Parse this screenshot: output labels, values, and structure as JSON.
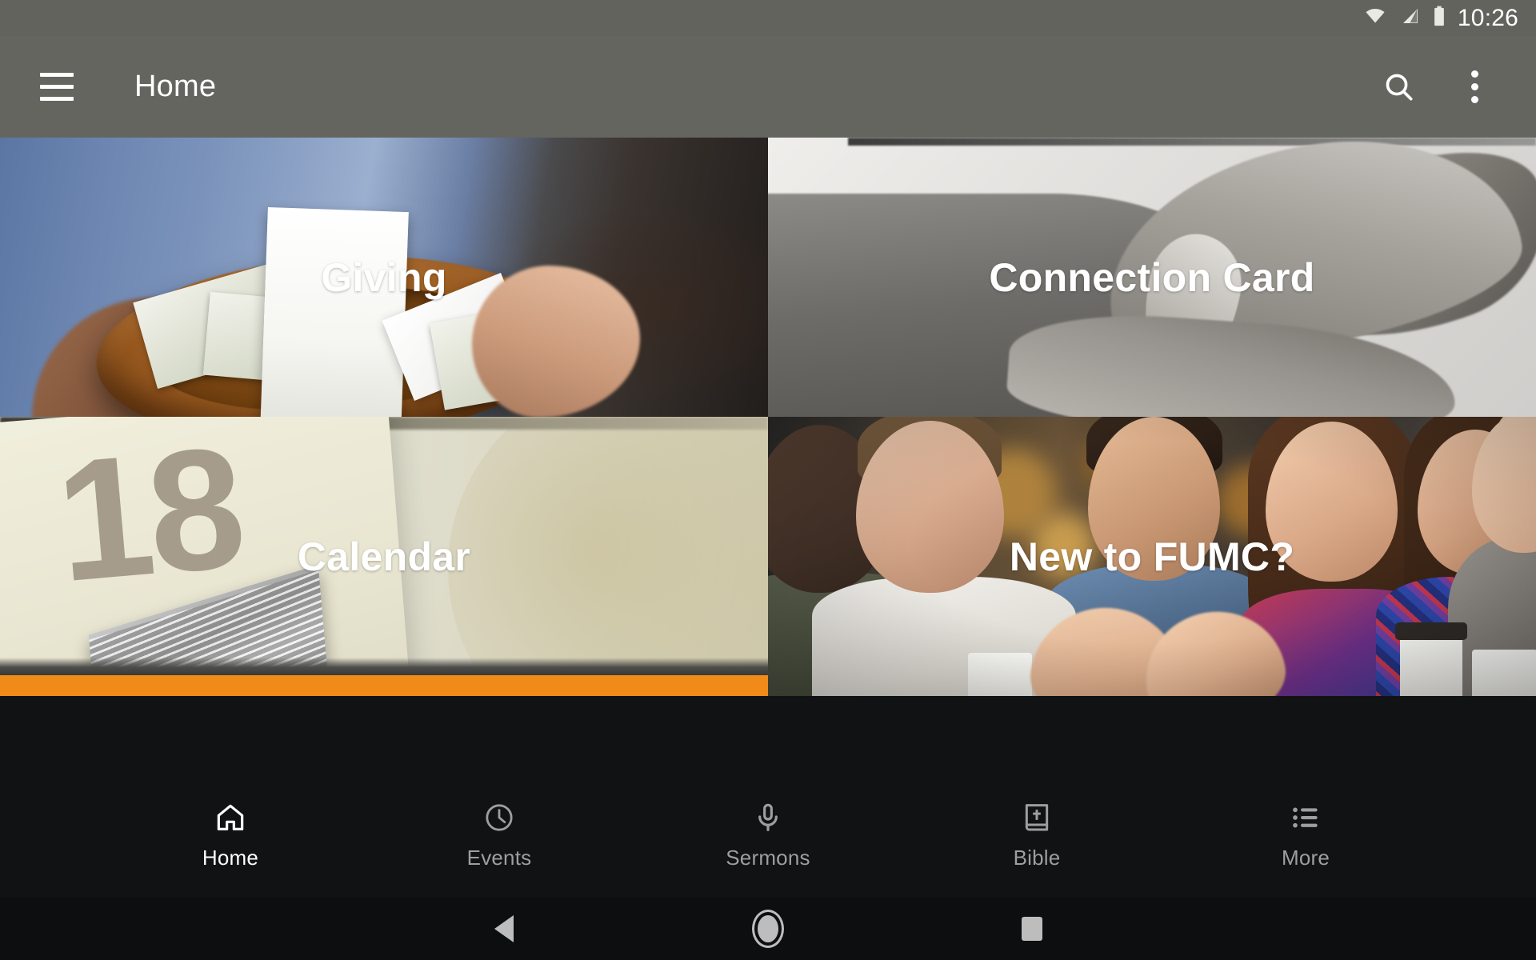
{
  "status_bar": {
    "time": "10:26",
    "icons": [
      "wifi-icon",
      "cell-signal-icon",
      "battery-icon"
    ]
  },
  "app_bar": {
    "menu_icon": "hamburger-menu-icon",
    "title": "Home",
    "search_icon": "search-icon",
    "overflow_icon": "overflow-menu-icon"
  },
  "tiles": [
    {
      "label": "Giving",
      "art": "offering-plate-with-money-photo"
    },
    {
      "label": "Connection Card",
      "art": "grayscale-handshake-photo"
    },
    {
      "label": "Calendar",
      "art": "flip-calendar-photo",
      "calendar_day": "18"
    },
    {
      "label": "New to FUMC?",
      "art": "group-of-friends-laughing-photo"
    }
  ],
  "bottom_nav": {
    "active": "Home",
    "items": [
      {
        "label": "Home",
        "icon": "house-icon",
        "active": true
      },
      {
        "label": "Events",
        "icon": "clock-icon",
        "active": false
      },
      {
        "label": "Sermons",
        "icon": "microphone-icon",
        "active": false
      },
      {
        "label": "Bible",
        "icon": "bible-book-icon",
        "active": false
      },
      {
        "label": "More",
        "icon": "list-icon",
        "active": false
      }
    ]
  },
  "system_nav": {
    "back": "back-triangle-icon",
    "home": "home-circle-icon",
    "recents": "recents-square-icon"
  },
  "colors": {
    "status_bar_bg": "#63635e",
    "app_bar_bg": "#656560",
    "nav_bg": "#111214",
    "system_nav_bg": "#0d0e10",
    "active_nav": "#ffffff",
    "inactive_nav": "#9e9e9e",
    "calendar_accent": "#f08a18"
  }
}
